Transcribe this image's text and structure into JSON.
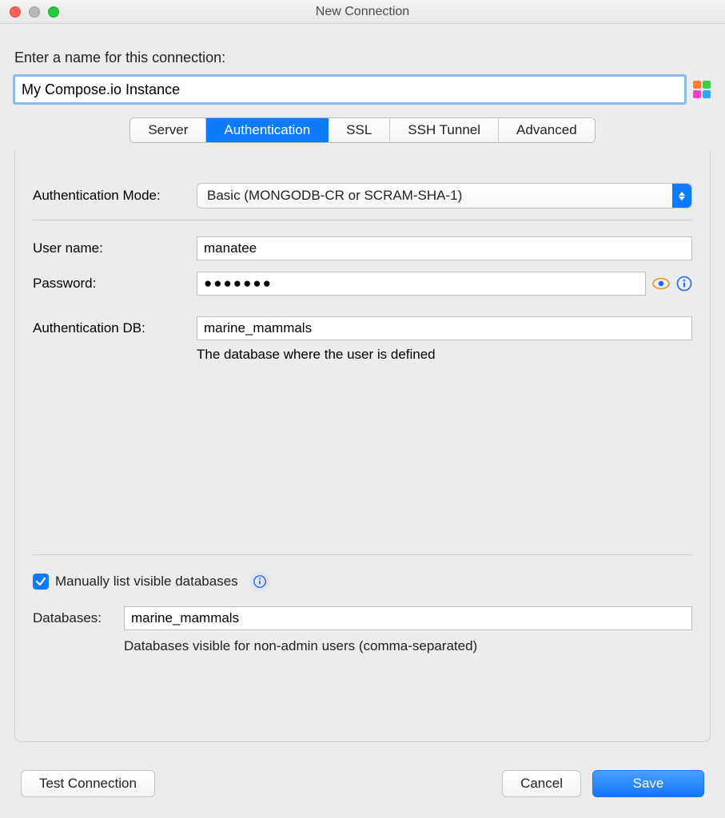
{
  "window": {
    "title": "New Connection"
  },
  "prompt": "Enter a name for this connection:",
  "connection_name": "My Compose.io Instance",
  "tabs": {
    "server": "Server",
    "authentication": "Authentication",
    "ssl": "SSL",
    "ssh_tunnel": "SSH Tunnel",
    "advanced": "Advanced"
  },
  "auth": {
    "mode_label": "Authentication Mode:",
    "mode_value": "Basic (MONGODB-CR or SCRAM-SHA-1)",
    "username_label": "User name:",
    "username_value": "manatee",
    "password_label": "Password:",
    "password_mask": "●●●●●●●",
    "authdb_label": "Authentication DB:",
    "authdb_value": "marine_mammals",
    "authdb_help": "The database where the user is defined"
  },
  "visible_db": {
    "checkbox_label": "Manually list visible databases",
    "databases_label": "Databases:",
    "databases_value": "marine_mammals",
    "databases_help": "Databases visible for non-admin users (comma-separated)"
  },
  "footer": {
    "test": "Test Connection",
    "cancel": "Cancel",
    "save": "Save"
  }
}
